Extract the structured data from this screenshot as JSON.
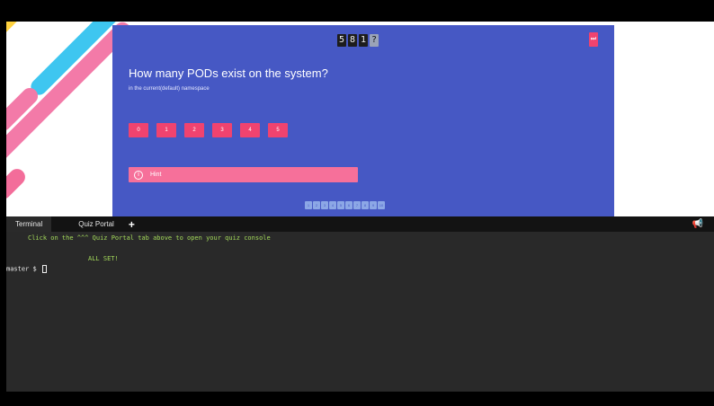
{
  "quiz": {
    "timer": [
      "5",
      "8",
      "1",
      "?"
    ],
    "skip_label": "⏭",
    "question": "How many PODs exist on the system?",
    "subtitle": "in the current(default) namespace",
    "answers": [
      "0",
      "1",
      "2",
      "3",
      "4",
      "5"
    ],
    "hint_label": "Hint",
    "pager": [
      "1",
      "2",
      "3",
      "4",
      "5",
      "6",
      "7",
      "8",
      "9",
      "10"
    ]
  },
  "terminal": {
    "tabs": [
      "Terminal",
      "Quiz Portal"
    ],
    "lines": {
      "instruction": "Click on the ^^^ Quiz Portal tab above to open your quiz console",
      "status": "ALL SET!",
      "prompt": "master $ "
    }
  },
  "colors": {
    "card": "#4658c4",
    "accent": "#f0436f",
    "terminal_bg": "#292929",
    "terminal_green": "#a3d95a"
  }
}
